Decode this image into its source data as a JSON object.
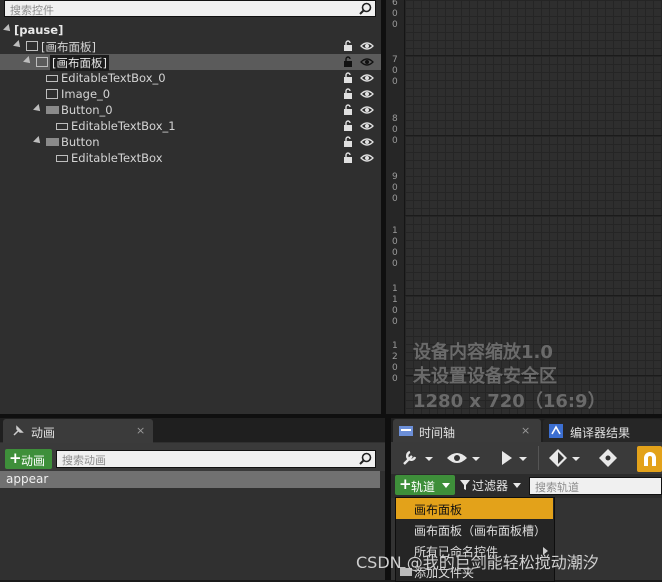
{
  "hierarchy": {
    "search_placeholder": "搜索控件",
    "rows": [
      {
        "label": "[pause]"
      },
      {
        "label": "[画布面板]"
      },
      {
        "label": "[画布面板]"
      },
      {
        "label": "EditableTextBox_0"
      },
      {
        "label": "Image_0"
      },
      {
        "label": "Button_0"
      },
      {
        "label": "EditableTextBox_1"
      },
      {
        "label": "Button"
      },
      {
        "label": "EditableTextBox"
      }
    ]
  },
  "designer": {
    "ruler_numbers": [
      [
        "6",
        "0",
        "0"
      ],
      [
        "7",
        "0",
        "0"
      ],
      [
        "8",
        "0",
        "0"
      ],
      [
        "9",
        "0",
        "0"
      ],
      [
        "1",
        "0",
        "0",
        "0"
      ],
      [
        "1",
        "1",
        "0",
        "0"
      ],
      [
        "1",
        "2",
        "0",
        "0"
      ]
    ],
    "overlay": {
      "line1": "设备内容缩放1.0",
      "line2": "未设置设备安全区",
      "line3": "1280 x 720（16:9）"
    }
  },
  "animations": {
    "tab_label": "动画",
    "tab_close": "×",
    "add_button": "动画",
    "search_placeholder": "搜索动画",
    "items": [
      "appear"
    ]
  },
  "timeline": {
    "tab_label": "时间轴",
    "tab_close": "×",
    "compiler_tab_label": "编译器结果",
    "track_button": "轨道",
    "filter_button": "过滤器",
    "search_placeholder": "搜索轨道",
    "menu_items": [
      "画布面板",
      "画布面板（画布面板槽）",
      "所有已命名控件",
      "添加文件夹"
    ]
  },
  "watermark": "CSDN @我的巨剑能轻松搅动潮汐",
  "colors": {
    "accent": "#e3a21a",
    "green": "#3e8f3a",
    "selection": "#5b5b5b"
  }
}
